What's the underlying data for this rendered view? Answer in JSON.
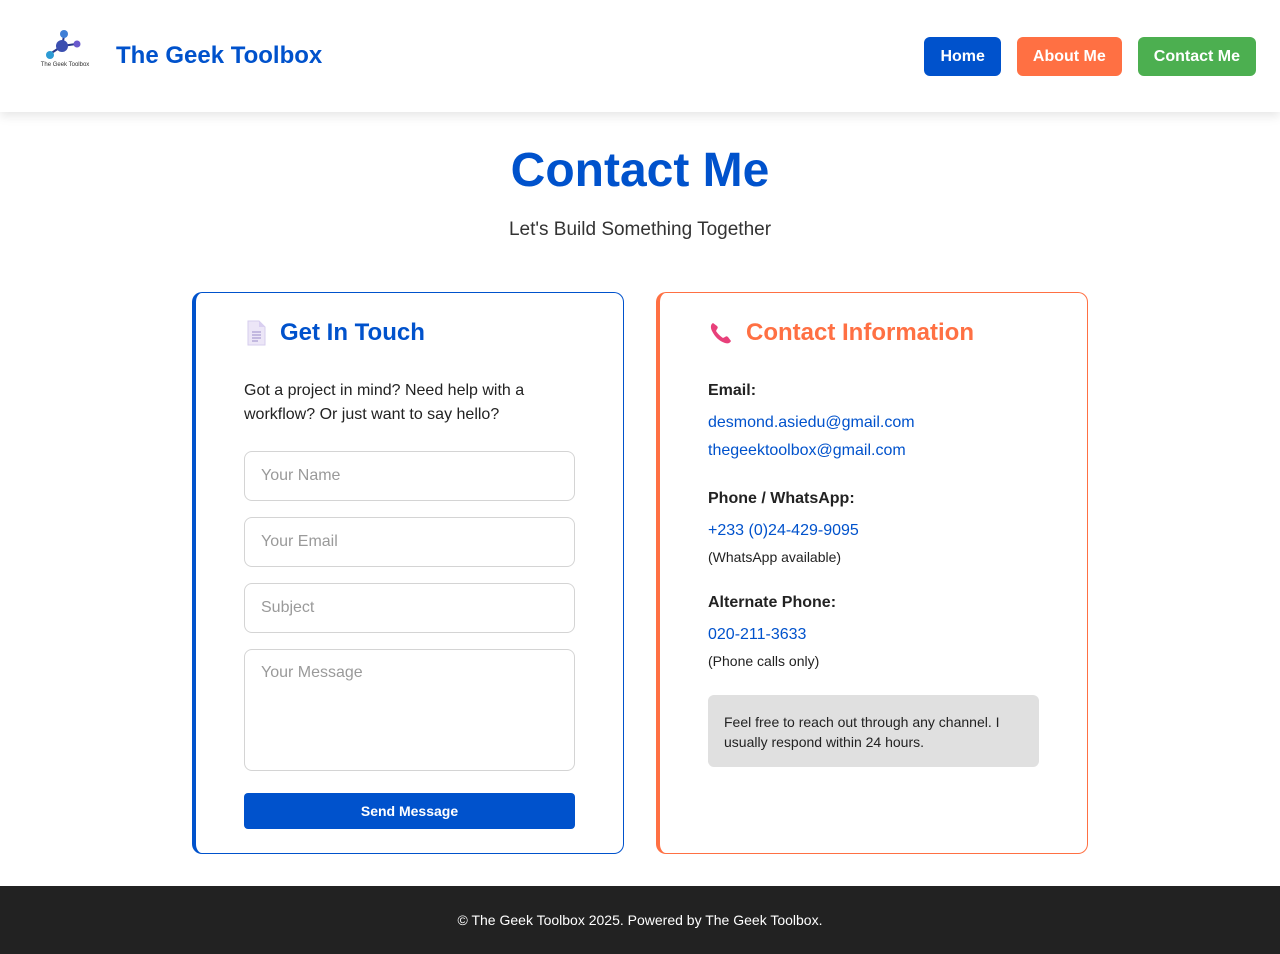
{
  "header": {
    "logo_caption": "The Geek Toolbox",
    "brand": "The Geek Toolbox",
    "nav": {
      "home": "Home",
      "about": "About Me",
      "contact": "Contact Me"
    }
  },
  "page": {
    "title": "Contact Me",
    "subtitle": "Let's Build Something Together"
  },
  "form_card": {
    "icon": "document-icon",
    "title": "Get In Touch",
    "intro": "Got a project in mind? Need help with a workflow? Or just want to say hello?",
    "placeholders": {
      "name": "Your Name",
      "email": "Your Email",
      "subject": "Subject",
      "message": "Your Message"
    },
    "submit_label": "Send Message"
  },
  "info_card": {
    "icon": "phone-icon",
    "title": "Contact Information",
    "email_label": "Email:",
    "emails": [
      "desmond.asiedu@gmail.com",
      "thegeektoolbox@gmail.com"
    ],
    "phone_label": "Phone / WhatsApp:",
    "phone": "+233 (0)24-429-9095",
    "phone_note": "(WhatsApp available)",
    "alt_phone_label": "Alternate Phone:",
    "alt_phone": "020-211-3633",
    "alt_phone_note": "(Phone calls only)",
    "note": "Feel free to reach out through any channel. I usually respond within 24 hours."
  },
  "footer": {
    "text": "© The Geek Toolbox 2025. Powered by The Geek Toolbox."
  },
  "colors": {
    "primary_blue": "#0052cc",
    "accent_orange": "#ff7043",
    "accent_green": "#4caf50",
    "footer_bg": "#222222"
  }
}
